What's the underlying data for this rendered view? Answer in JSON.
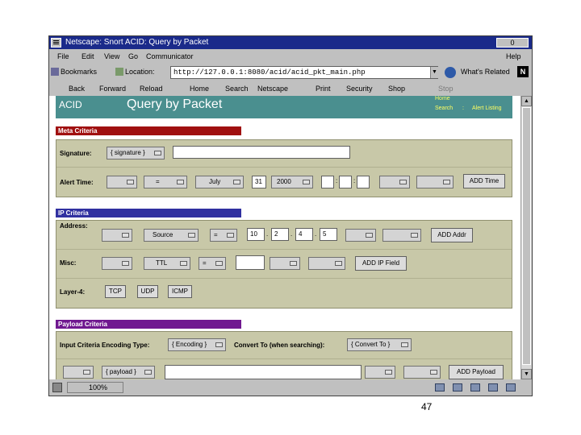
{
  "window": {
    "title": "Netscape: Snort ACID: Query by Packet",
    "mx": "0"
  },
  "menu": [
    "File",
    "Edit",
    "View",
    "Go",
    "Communicator",
    "Help"
  ],
  "location": {
    "bookmarks": "Bookmarks",
    "label": "Location:",
    "url": "http://127.0.0.1:8080/acid/acid_pkt_main.php",
    "whats_related": "What's Related"
  },
  "toolbar": [
    "Back",
    "Forward",
    "Reload",
    "Home",
    "Search",
    "Netscape",
    "Print",
    "Security",
    "Shop",
    "Stop"
  ],
  "header": {
    "acid": "ACID",
    "title": "Query by Packet",
    "home": "Home",
    "search": "Search",
    "sep": ":",
    "alert_listing": "Alert Listing"
  },
  "meta": {
    "heading": "Meta Criteria",
    "signature_label": "Signature:",
    "signature_select": "{ signature }",
    "alert_time_label": "Alert Time:",
    "time_op": "=",
    "month": "July",
    "day": "31",
    "year": "2000",
    "add_time": "ADD Time"
  },
  "ip": {
    "heading": "IP Criteria",
    "address_label": "Address:",
    "source": "Source",
    "addr_op": "=",
    "oct1": "10",
    "oct2": "2",
    "oct3": "4",
    "oct4": "5",
    "add_addr": "ADD Addr",
    "misc_label": "Misc:",
    "ttl": "TTL",
    "misc_op": "=",
    "add_ip_field": "ADD IP Field",
    "layer4_label": "Layer-4:",
    "tcp": "TCP",
    "udp": "UDP",
    "icmp": "ICMP"
  },
  "payload": {
    "heading": "Payload Criteria",
    "enc_label": "Input Criteria Encoding Type:",
    "encoding": "{ Encoding }",
    "convert_label": "Convert To (when searching):",
    "convert": "{ Convert To }",
    "payload_select": "{ payload }",
    "add_payload": "ADD Payload"
  },
  "status": {
    "zoom": "100%"
  },
  "page_number": "47",
  "colors": {
    "title_bg": "#1a2a8a",
    "header_bg": "#4a8f8f",
    "meta_bar": "#a01010",
    "ip_bar": "#3030a0",
    "payload_bar": "#701890",
    "panel_bg": "#c8c8a8"
  }
}
